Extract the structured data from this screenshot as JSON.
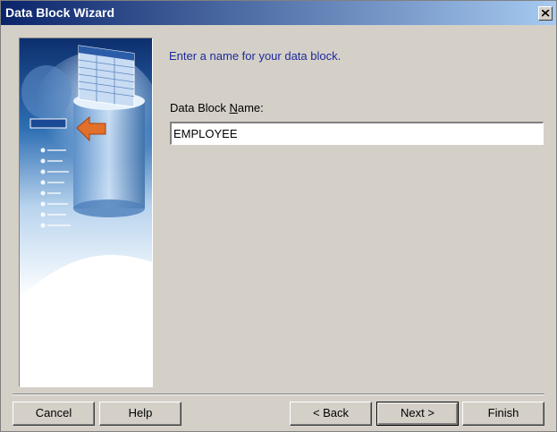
{
  "window": {
    "title": "Data Block Wizard"
  },
  "content": {
    "instruction": "Enter a name for your data block.",
    "field_label_before": "Data Block ",
    "field_label_underlined": "N",
    "field_label_after": "ame:",
    "block_name_value": "EMPLOYEE"
  },
  "buttons": {
    "cancel": "Cancel",
    "help": "Help",
    "back": "< Back",
    "next": "Next >",
    "finish": "Finish"
  },
  "icons": {
    "close": "close-icon",
    "wizard_art": "database-illustration"
  },
  "colors": {
    "titlebar_start": "#0a246a",
    "titlebar_end": "#a6caf0",
    "instruction_text": "#1e2a9a",
    "dialog_bg": "#d4d0c8"
  }
}
